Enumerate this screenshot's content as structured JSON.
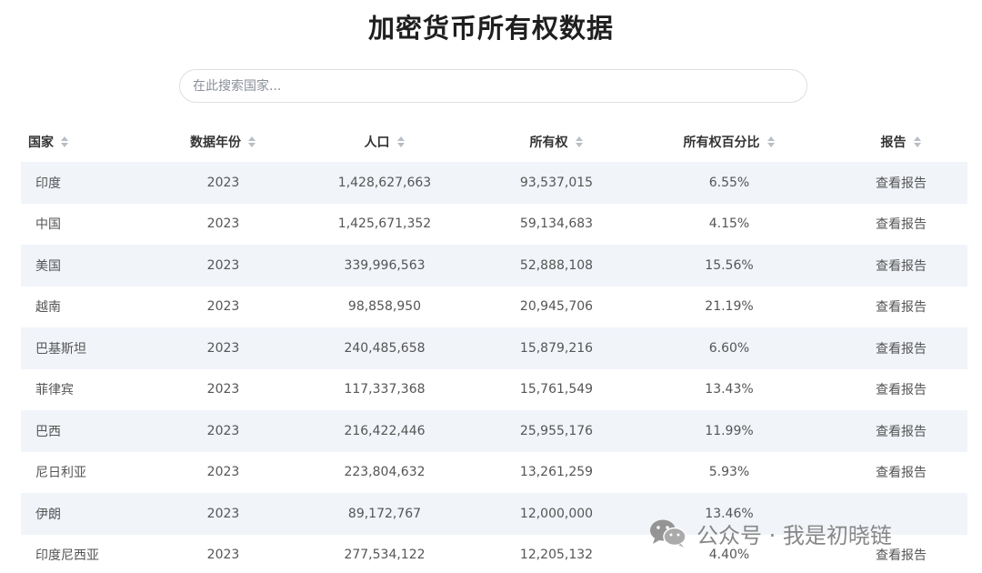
{
  "page": {
    "title": "加密货币所有权数据"
  },
  "search": {
    "placeholder": "在此搜索国家..."
  },
  "table": {
    "columns": [
      "国家",
      "数据年份",
      "人口",
      "所有权",
      "所有权百分比",
      "报告"
    ],
    "rows": [
      {
        "country": "印度",
        "year": "2023",
        "population": "1,428,627,663",
        "ownership": "93,537,015",
        "percent": "6.55%",
        "report": "查看报告"
      },
      {
        "country": "中国",
        "year": "2023",
        "population": "1,425,671,352",
        "ownership": "59,134,683",
        "percent": "4.15%",
        "report": "查看报告"
      },
      {
        "country": "美国",
        "year": "2023",
        "population": "339,996,563",
        "ownership": "52,888,108",
        "percent": "15.56%",
        "report": "查看报告"
      },
      {
        "country": "越南",
        "year": "2023",
        "population": "98,858,950",
        "ownership": "20,945,706",
        "percent": "21.19%",
        "report": "查看报告"
      },
      {
        "country": "巴基斯坦",
        "year": "2023",
        "population": "240,485,658",
        "ownership": "15,879,216",
        "percent": "6.60%",
        "report": "查看报告"
      },
      {
        "country": "菲律宾",
        "year": "2023",
        "population": "117,337,368",
        "ownership": "15,761,549",
        "percent": "13.43%",
        "report": "查看报告"
      },
      {
        "country": "巴西",
        "year": "2023",
        "population": "216,422,446",
        "ownership": "25,955,176",
        "percent": "11.99%",
        "report": "查看报告"
      },
      {
        "country": "尼日利亚",
        "year": "2023",
        "population": "223,804,632",
        "ownership": "13,261,259",
        "percent": "5.93%",
        "report": "查看报告"
      },
      {
        "country": "伊朗",
        "year": "2023",
        "population": "89,172,767",
        "ownership": "12,000,000",
        "percent": "13.46%",
        "report": ""
      },
      {
        "country": "印度尼西亚",
        "year": "2023",
        "population": "277,534,122",
        "ownership": "12,205,132",
        "percent": "4.40%",
        "report": "查看报告"
      }
    ]
  },
  "watermark": {
    "text": "公众号 · 我是初晓链",
    "icon": "wechat-icon"
  }
}
